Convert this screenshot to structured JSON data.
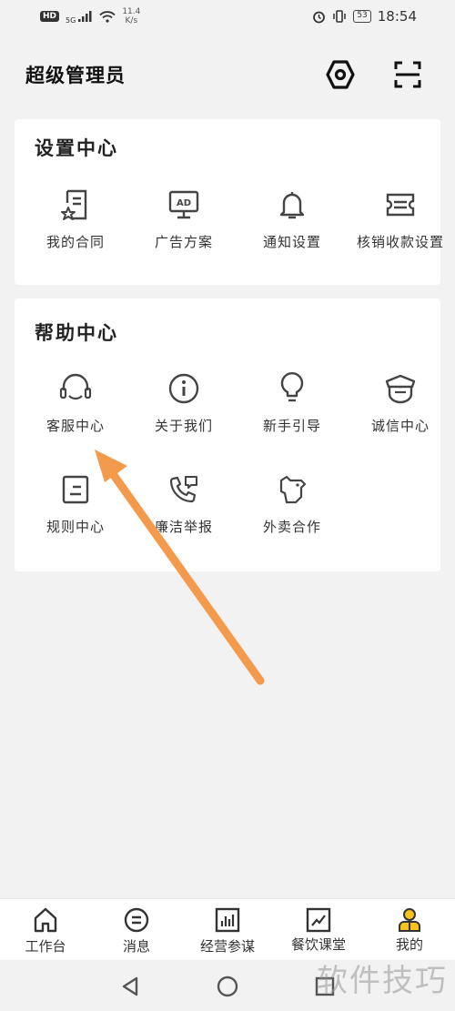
{
  "status_bar": {
    "network_badge": "HD",
    "network_type": "5G",
    "net_speed_value": "11.4",
    "net_speed_unit": "K/s",
    "battery": "53",
    "time": "18:54"
  },
  "header": {
    "title": "超级管理员",
    "settings_icon": "hexagon-settings-icon",
    "scan_icon": "scan-icon"
  },
  "settings_center": {
    "title": "设置中心",
    "items": [
      {
        "label": "我的合同",
        "icon": "contract-icon"
      },
      {
        "label": "广告方案",
        "icon": "ad-monitor-icon"
      },
      {
        "label": "通知设置",
        "icon": "bell-icon"
      },
      {
        "label": "核销收款设置",
        "icon": "ticket-icon"
      }
    ]
  },
  "help_center": {
    "title": "帮助中心",
    "items": [
      {
        "label": "客服中心",
        "icon": "headset-icon"
      },
      {
        "label": "关于我们",
        "icon": "info-icon"
      },
      {
        "label": "新手引导",
        "icon": "lightbulb-icon"
      },
      {
        "label": "诚信中心",
        "icon": "police-cap-icon"
      },
      {
        "label": "规则中心",
        "icon": "rules-icon"
      },
      {
        "label": "廉洁举报",
        "icon": "phone-report-icon"
      },
      {
        "label": "外卖合作",
        "icon": "delivery-icon"
      }
    ]
  },
  "tabbar": {
    "tabs": [
      {
        "label": "工作台",
        "icon": "home-icon"
      },
      {
        "label": "消息",
        "icon": "message-icon"
      },
      {
        "label": "经营参谋",
        "icon": "bar-chart-icon"
      },
      {
        "label": "餐饮课堂",
        "icon": "trend-chart-icon"
      },
      {
        "label": "我的",
        "icon": "user-icon",
        "active": true
      }
    ],
    "active_color": "#f6c21c"
  },
  "colors": {
    "accent": "#f6c21c",
    "arrow": "#f39a4c"
  },
  "watermark": "软件技巧"
}
